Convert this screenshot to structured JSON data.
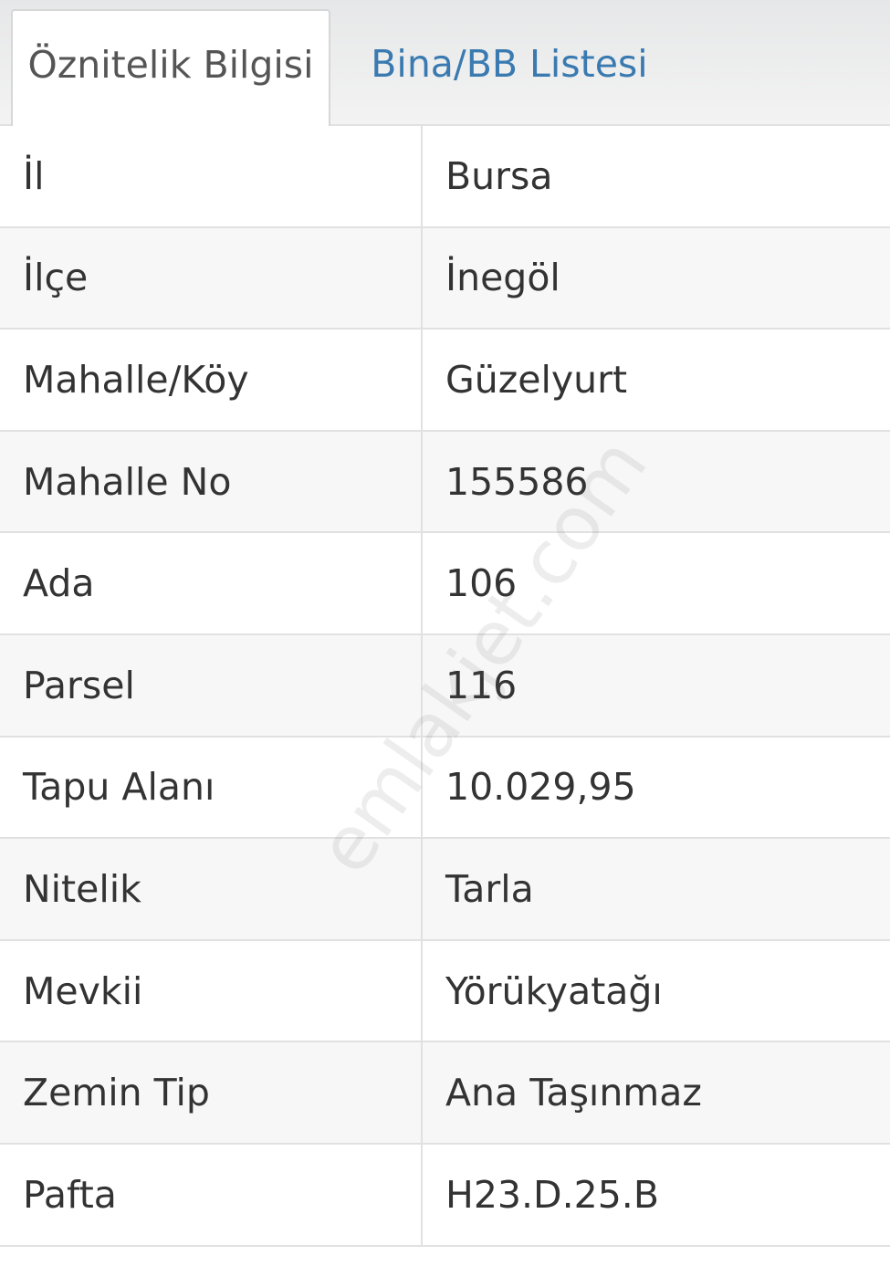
{
  "tabs": [
    {
      "label": "Öznitelik Bilgisi",
      "active": true
    },
    {
      "label": "Bina/BB Listesi",
      "active": false
    }
  ],
  "rows": [
    {
      "key": "İl",
      "value": "Bursa"
    },
    {
      "key": "İlçe",
      "value": "İnegöl"
    },
    {
      "key": "Mahalle/Köy",
      "value": "Güzelyurt"
    },
    {
      "key": "Mahalle No",
      "value": "155586"
    },
    {
      "key": "Ada",
      "value": "106"
    },
    {
      "key": "Parsel",
      "value": "116"
    },
    {
      "key": "Tapu Alanı",
      "value": "10.029,95"
    },
    {
      "key": "Nitelik",
      "value": "Tarla"
    },
    {
      "key": "Mevkii",
      "value": "Yörükyatağı"
    },
    {
      "key": "Zemin Tip",
      "value": "Ana Taşınmaz"
    },
    {
      "key": "Pafta",
      "value": "H23.D.25.B"
    }
  ],
  "watermark": "emlakjet.com",
  "colors": {
    "tab_active_text": "#555555",
    "tab_inactive_text": "#3a7ab0",
    "cell_text": "#333333",
    "row_alt_bg": "#f7f7f7"
  }
}
